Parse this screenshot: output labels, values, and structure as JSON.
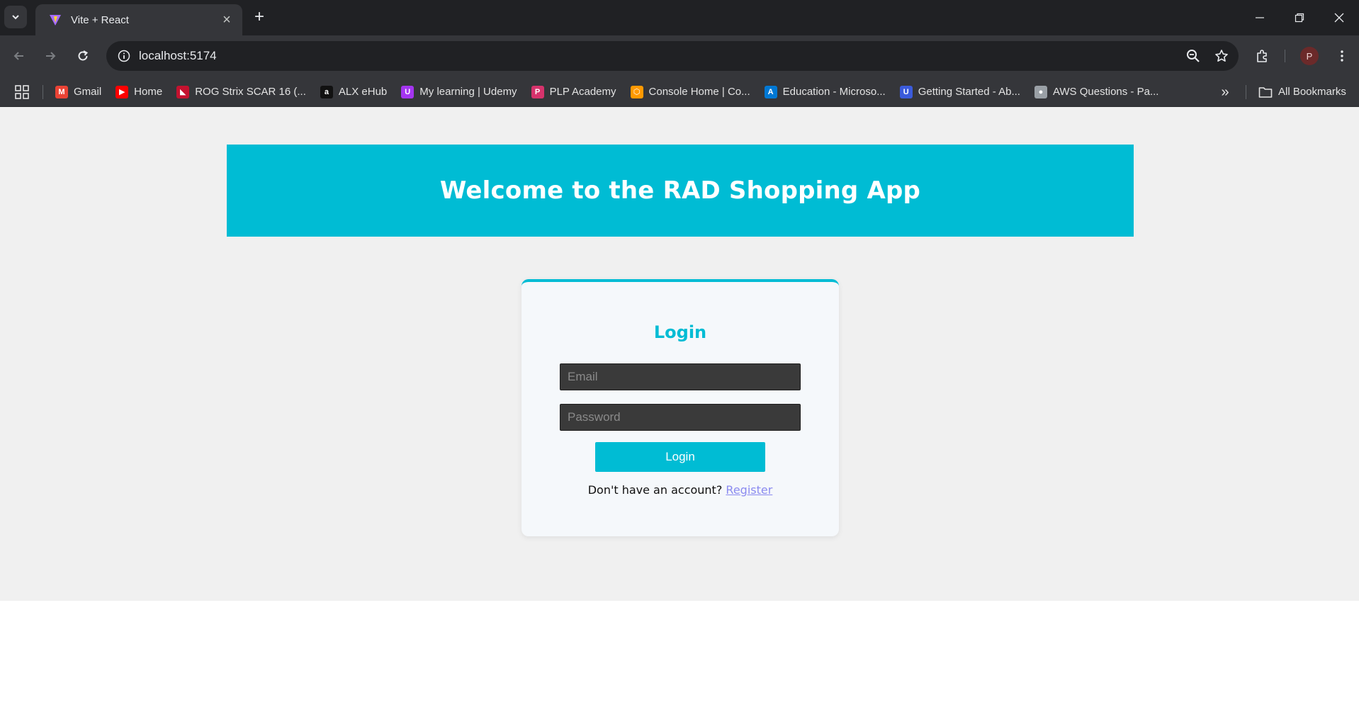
{
  "browser": {
    "tab_title": "Vite + React",
    "url": "localhost:5174",
    "avatar_letter": "P",
    "bookmarks": [
      {
        "label": "Gmail",
        "icon": "gmail-icon",
        "color": "#ea4335"
      },
      {
        "label": "Home",
        "icon": "youtube-icon",
        "color": "#ff0000"
      },
      {
        "label": "ROG Strix SCAR 16 (...",
        "icon": "rog-icon",
        "color": "#c4122f"
      },
      {
        "label": "ALX eHub",
        "icon": "alx-icon",
        "color": "#111111"
      },
      {
        "label": "My learning | Udemy",
        "icon": "udemy-icon",
        "color": "#a435f0"
      },
      {
        "label": "PLP Academy",
        "icon": "plp-icon",
        "color": "#d6336c"
      },
      {
        "label": "Console Home | Co...",
        "icon": "aws-icon",
        "color": "#ff9900"
      },
      {
        "label": "Education - Microso...",
        "icon": "azure-icon",
        "color": "#0078d4"
      },
      {
        "label": "Getting Started - Ab...",
        "icon": "abp-icon",
        "color": "#3b5bdb"
      },
      {
        "label": "AWS Questions - Pa...",
        "icon": "globe-icon",
        "color": "#9aa0a6"
      }
    ],
    "all_bookmarks_label": "All Bookmarks"
  },
  "header": {
    "title": "Welcome to the RAD Shopping App"
  },
  "login": {
    "title": "Login",
    "email_placeholder": "Email",
    "password_placeholder": "Password",
    "button_label": "Login",
    "footer_text": "Don't have an account?",
    "register_label": "Register"
  },
  "colors": {
    "accent": "#00bcd4",
    "page_bg": "#f0f0f0",
    "link": "#8b8bf0"
  }
}
